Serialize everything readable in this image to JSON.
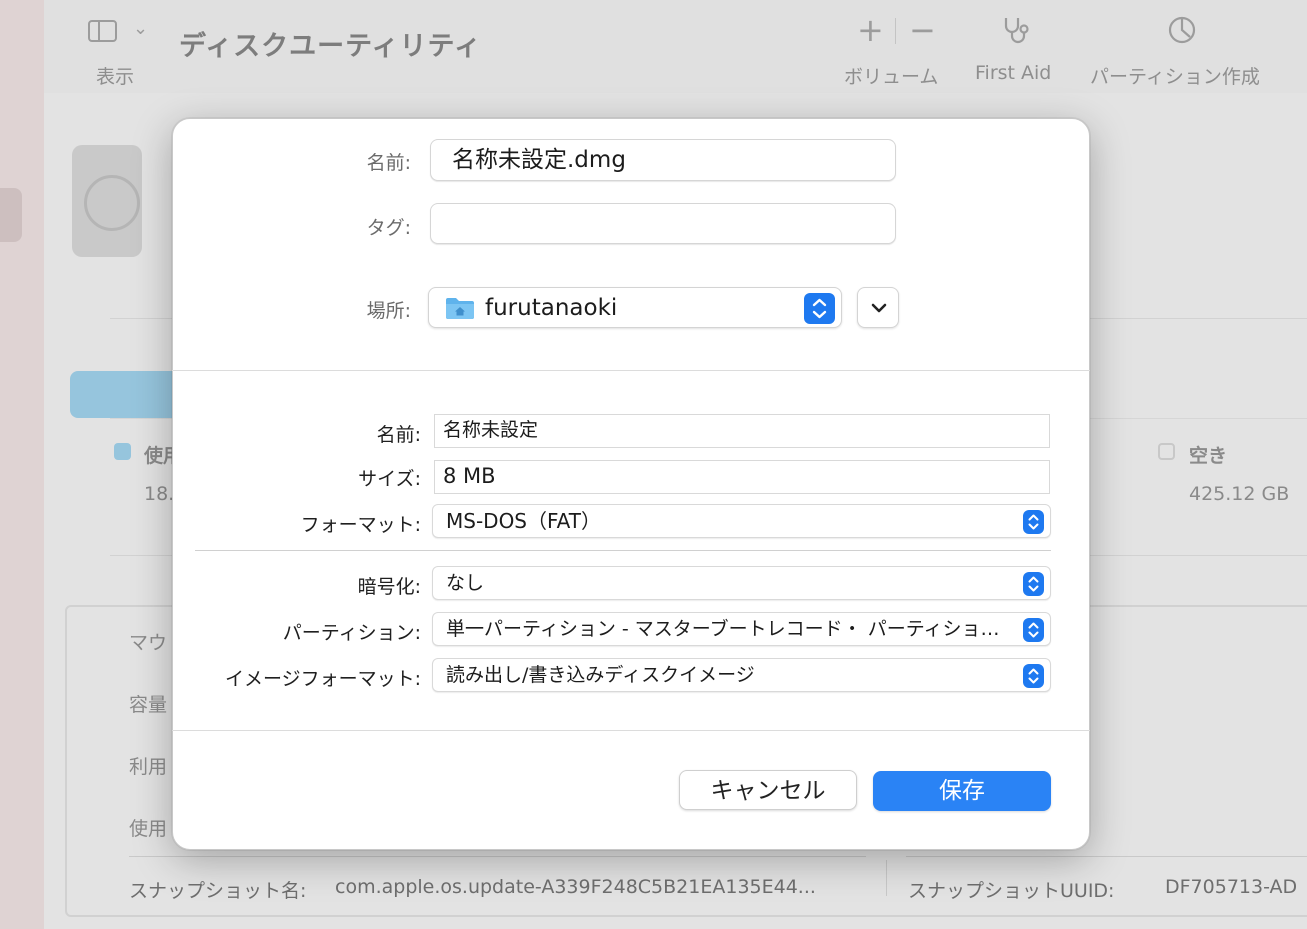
{
  "background": {
    "toolbar": {
      "view_label": "表示",
      "title": "ディスクユーティリティ",
      "volume_label": "ボリューム",
      "first_aid_label": "First Aid",
      "partition_label": "パーティション作成"
    },
    "legend": {
      "used_label": "使用",
      "used_value": "18.",
      "free_label": "空き",
      "free_value": "425.12 GB"
    },
    "info": {
      "mount_label": "マウ",
      "capacity_label": "容量",
      "available_label": "利用",
      "used_label": "使用",
      "snapshot_name_label": "スナップショット名:",
      "snapshot_name_value": "com.apple.os.update-A339F248C5B21EA135E44...",
      "snapshot_uuid_label": "スナップショットUUID:",
      "snapshot_uuid_value": "DF705713-AD"
    }
  },
  "sheet": {
    "save_as": {
      "label": "名前:",
      "value": "名称未設定.dmg"
    },
    "tags": {
      "label": "タグ:",
      "value": ""
    },
    "where": {
      "label": "場所:",
      "value": "furutanaoki",
      "icon": "home-folder-icon"
    },
    "image": {
      "name": {
        "label": "名前:",
        "value": "名称未設定"
      },
      "size": {
        "label": "サイズ:",
        "value": "8 MB"
      },
      "format": {
        "label": "フォーマット:",
        "value": "MS-DOS（FAT）"
      },
      "encryption": {
        "label": "暗号化:",
        "value": "なし"
      },
      "partitions": {
        "label": "パーティション:",
        "value": "単一パーティション - マスターブートレコード・ パーティショ…"
      },
      "image_format": {
        "label": "イメージフォーマット:",
        "value": "読み出し/書き込みディスクイメージ"
      }
    },
    "buttons": {
      "cancel": "キャンセル",
      "save": "保存"
    }
  },
  "colors": {
    "accent": "#2a83f5",
    "stepper": "#1e79f0",
    "folder": "#5fb3ec"
  }
}
